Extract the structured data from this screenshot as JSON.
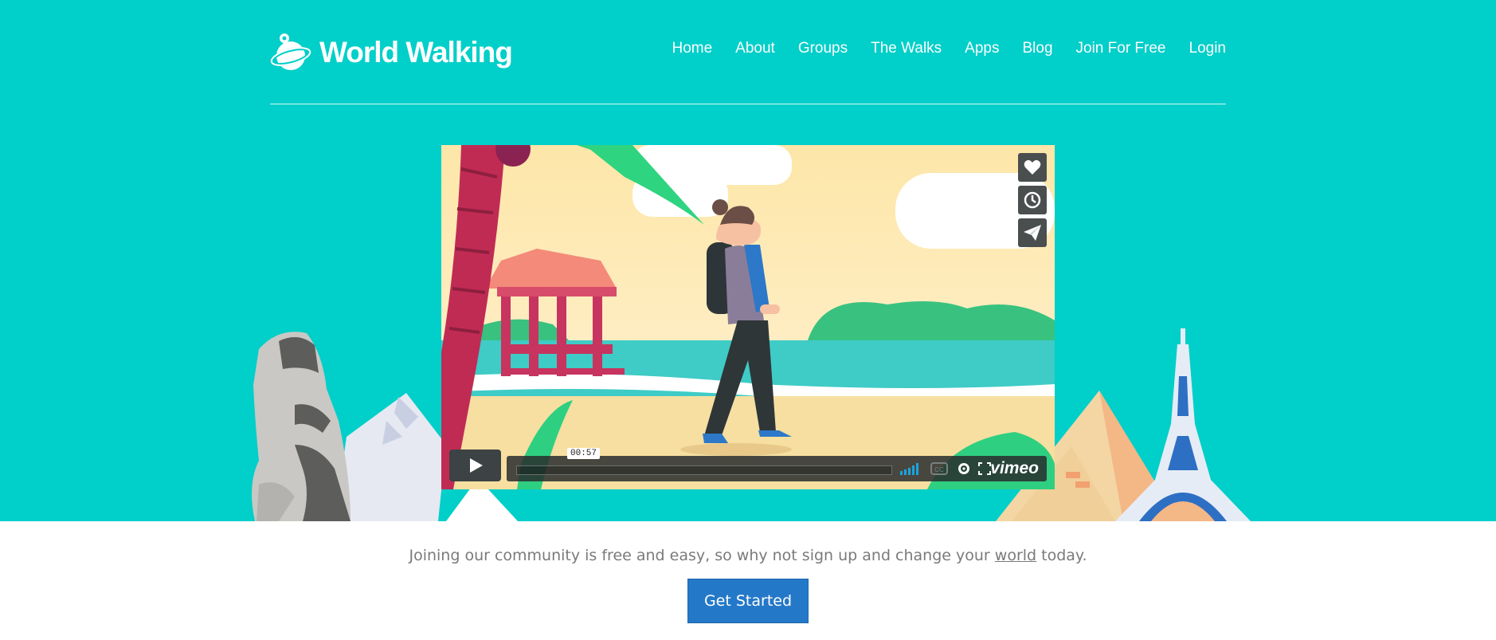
{
  "brand": {
    "name": "World Walking",
    "logo_icon": "globe-walker-logo"
  },
  "nav": {
    "items": [
      {
        "label": "Home"
      },
      {
        "label": "About"
      },
      {
        "label": "Groups"
      },
      {
        "label": "The Walks"
      },
      {
        "label": "Apps"
      },
      {
        "label": "Blog"
      },
      {
        "label": "Join For Free"
      },
      {
        "label": "Login"
      }
    ]
  },
  "video": {
    "time": "00:57",
    "provider": "vimeo",
    "actions": [
      "heart-icon",
      "clock-icon",
      "paper-plane-icon"
    ],
    "controls": [
      "play-icon",
      "volume-icon",
      "cc-icon",
      "gear-icon",
      "fullscreen-icon"
    ]
  },
  "cta": {
    "tagline_before": "Joining our community is free and easy, so why not sign up and change your ",
    "tagline_link": "world",
    "tagline_after": " today.",
    "button_label": "Get Started"
  },
  "colors": {
    "hero_bg": "#01cfc9",
    "cta_bg": "#2478c8",
    "text_gray": "#7a7a7a"
  }
}
